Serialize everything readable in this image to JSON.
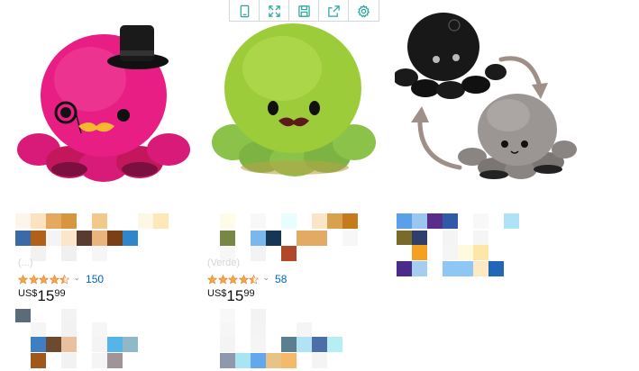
{
  "toolbar": {
    "buttons": [
      {
        "icon": "tablet-icon"
      },
      {
        "icon": "expand-icon"
      },
      {
        "icon": "save-icon"
      },
      {
        "icon": "share-icon"
      },
      {
        "icon": "gear-icon"
      }
    ],
    "accent": "#26a69a"
  },
  "products": [
    {
      "image": "pink-octopus-plush-with-top-hat",
      "faint_label": "(...)",
      "rating_stars": 4.5,
      "review_count": "150",
      "price_symbol": "US$",
      "price_whole": "15",
      "price_fraction": "99"
    },
    {
      "image": "green-octopus-plush-with-mustache",
      "faint_label": "(Verde)",
      "rating_stars": 4.5,
      "review_count": "58",
      "price_symbol": "US$",
      "price_whole": "15",
      "price_fraction": "99"
    },
    {
      "image": "reversible-octopus-plush-black-and-grey"
    }
  ],
  "colors": {
    "star": "#f3a847",
    "link": "#0066c0"
  }
}
